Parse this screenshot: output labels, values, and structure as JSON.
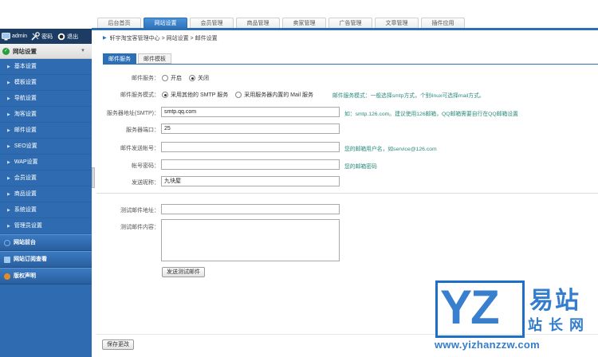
{
  "top_tabs": [
    "后台首页",
    "网站设置",
    "会员管理",
    "商品管理",
    "卖家管理",
    "广告管理",
    "文章管理",
    "插件应用"
  ],
  "active_tab_index": 1,
  "userbar": {
    "user": "admin",
    "password_label": "密码",
    "logout_label": "退出"
  },
  "sidebar": {
    "group_title": "网站设置",
    "items": [
      "基本设置",
      "模板设置",
      "导航设置",
      "淘客设置",
      "邮件设置",
      "SEO设置",
      "WAP设置",
      "会员设置",
      "商品设置",
      "系统设置",
      "管理员设置"
    ],
    "sections": [
      "网站前台",
      "网站订阅查看",
      "版权声明"
    ]
  },
  "breadcrumb": "轩宇淘宝客管理中心 > 网站设置 > 邮件设置",
  "sub_tabs": [
    "邮件服务",
    "邮件模板"
  ],
  "form": {
    "mail_service": {
      "label": "邮件服务：",
      "options": [
        "开启",
        "关闭"
      ],
      "selected": "关闭"
    },
    "mail_mode": {
      "label": "邮件服务模式：",
      "options": [
        "采用其他的 SMTP 服务",
        "采用服务器内置的 Mail 服务"
      ],
      "selected": "采用其他的 SMTP 服务",
      "hint": "邮件服务模式：一般选择smtp方式，个别linux可选择mail方式。"
    },
    "smtp_server": {
      "label": "服务器地址(SMTP)：",
      "value": "smtp.qq.com",
      "hint": "如：smtp.126.com。建议使用126邮箱，QQ邮箱需要自行在QQ邮箱设置"
    },
    "smtp_port": {
      "label": "服务器端口：",
      "value": "25"
    },
    "sender_account": {
      "label": "邮件发送帐号：",
      "value": "",
      "hint": "您的邮箱用户名，如service@126.com"
    },
    "account_password": {
      "label": "帐号密码：",
      "value": "",
      "hint": "您的邮箱密码"
    },
    "sender_name": {
      "label": "发送昵称：",
      "value": "九块屋"
    },
    "test_address": {
      "label": "测试邮件地址：",
      "value": ""
    },
    "test_content": {
      "label": "测试邮件内容：",
      "value": ""
    },
    "send_test_button": "发送测试邮件",
    "save_button": "保存更改"
  },
  "watermark": {
    "mark": "YZ",
    "cn_top": "易站",
    "cn_bottom": "站长网",
    "url": "www.yizhanzzw.com"
  },
  "colors": {
    "accent": "#2b6fb7",
    "sidebar": "#2f6bb1",
    "hint": "#2a8c7c",
    "watermark": "#1d6fc7"
  }
}
